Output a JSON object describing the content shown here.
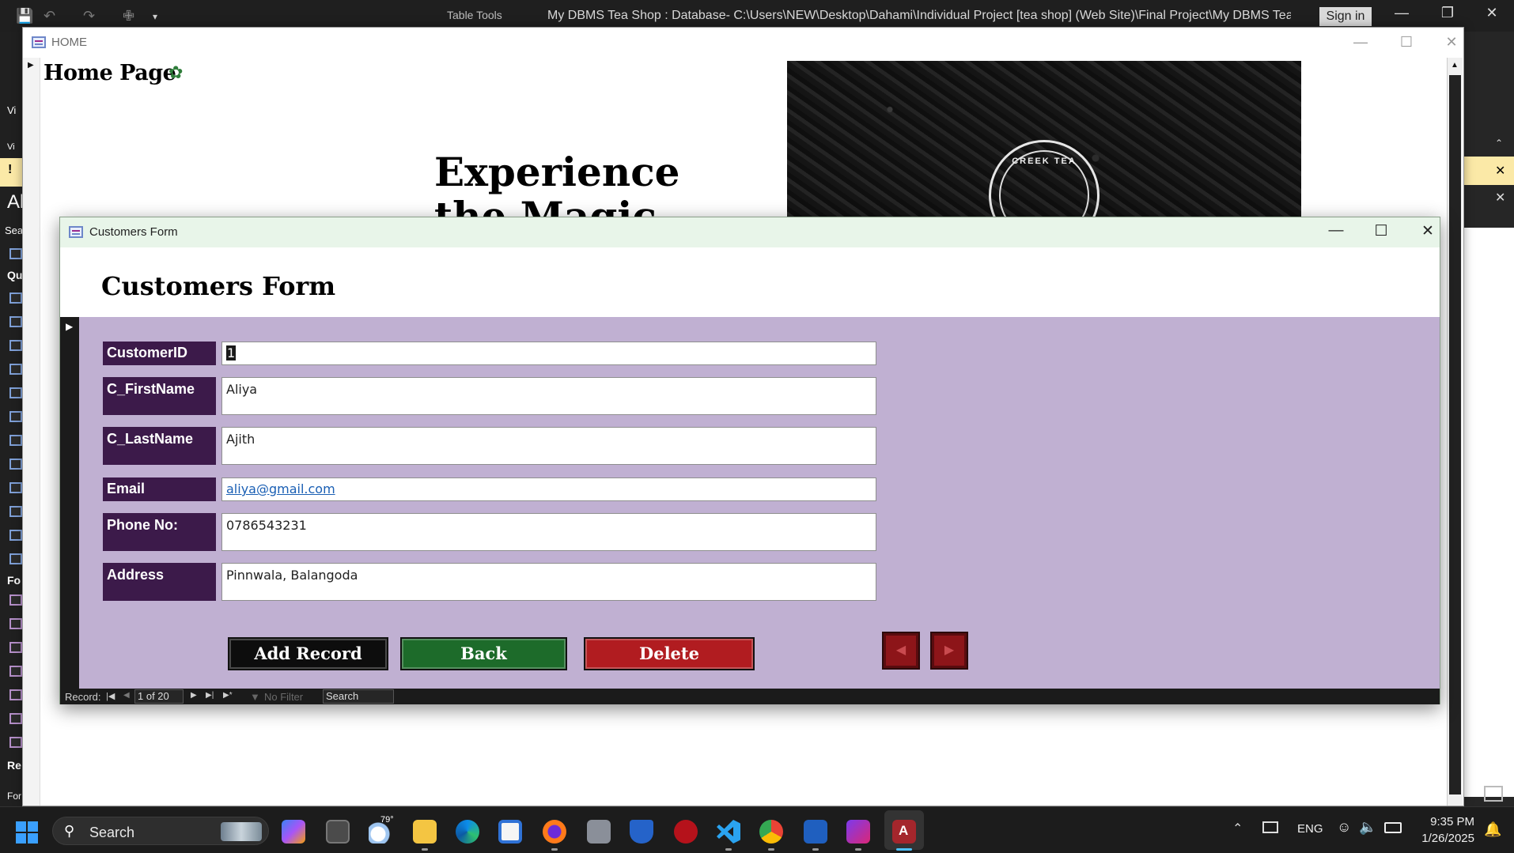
{
  "access": {
    "context_tab": "Table Tools",
    "title": "My DBMS Tea Shop : Database- C:\\Users\\NEW\\Desktop\\Dahami\\Individual Project [tea shop] (Web Site)\\Final Project\\My DBMS Tea Shop.a...",
    "sign_in": "Sign in"
  },
  "home_form": {
    "window_title": "HOME",
    "heading": "Home Page",
    "tagline": "Experience the Magic",
    "logo_text": "CREEK TEA"
  },
  "nav_pane": {
    "peek_labels": [
      "Vi",
      "Vi",
      "Al",
      "Sea",
      "Qu",
      "Fo",
      "Re",
      "For"
    ]
  },
  "customers_form": {
    "window_title": "Customers Form",
    "heading": "Customers Form",
    "fields": {
      "customer_id": {
        "label": "CustomerID",
        "value": "1"
      },
      "first_name": {
        "label": "C_FirstName",
        "value": "Aliya"
      },
      "last_name": {
        "label": "C_LastName",
        "value": "Ajith"
      },
      "email": {
        "label": "Email",
        "value": "aliya@gmail.com"
      },
      "phone": {
        "label": "Phone No:",
        "value": "0786543231"
      },
      "address": {
        "label": "Address",
        "value": "Pinnwala, Balangoda"
      }
    },
    "buttons": {
      "add": "Add Record",
      "back": "Back",
      "delete": "Delete"
    },
    "record_nav": {
      "label": "Record:",
      "position": "1 of 20",
      "filter": "No Filter",
      "search": "Search"
    }
  },
  "taskbar": {
    "search_label": "Search",
    "weather_temp": "79°",
    "language": "ENG",
    "time": "9:35 PM",
    "date": "1/26/2025"
  }
}
